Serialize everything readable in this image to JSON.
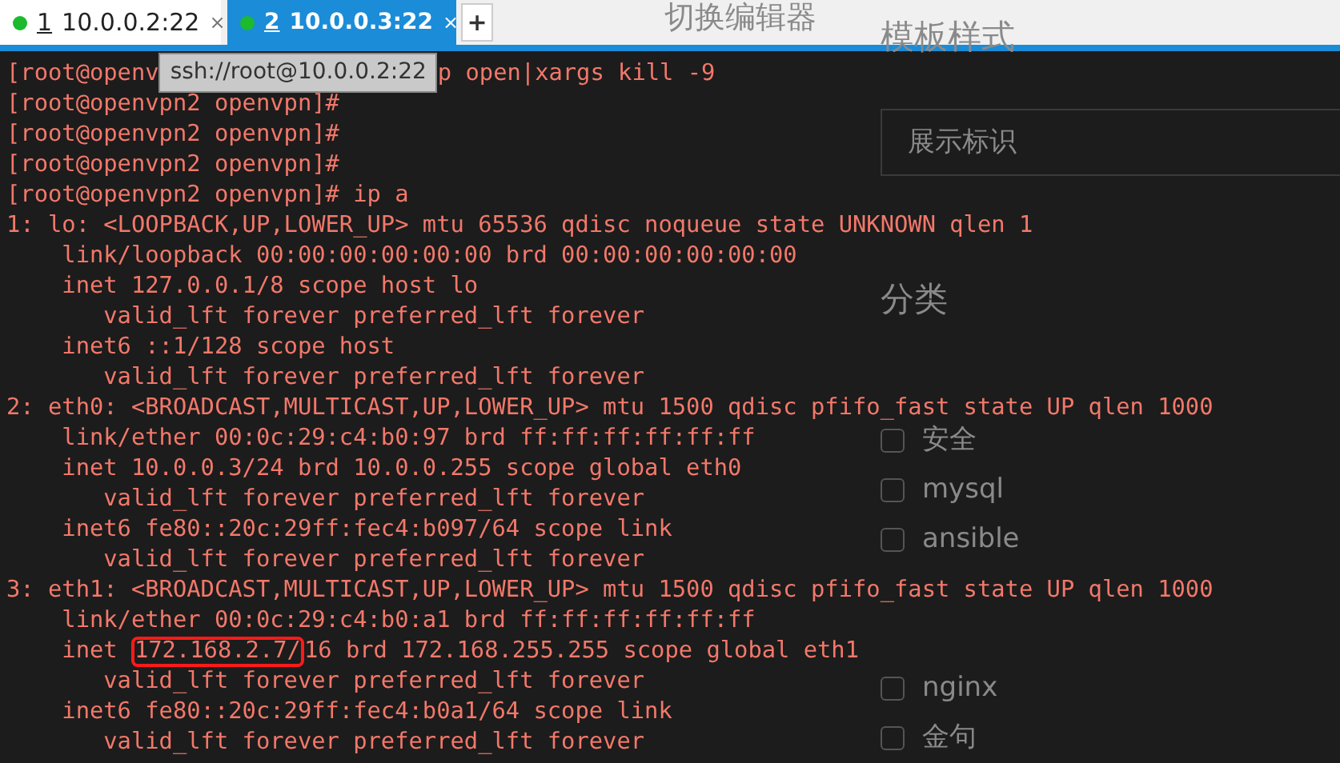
{
  "tabs": [
    {
      "number": "1",
      "title": "10.0.0.2:22",
      "close": "×",
      "selected": false,
      "connected": true
    },
    {
      "number": "2",
      "title": "10.0.0.3:22",
      "close": "×",
      "selected": true,
      "connected": true
    }
  ],
  "new_tab": "+",
  "editor_switch": "切换编辑器",
  "terminal": {
    "lines": [
      {
        "kind": "tooltip",
        "before": "[root@openv",
        "tooltip": "ssh://root@10.0.0.2:22",
        "after": "p open|xargs kill -9"
      },
      {
        "kind": "plain",
        "text": "[root@openvpn2 openvpn]#"
      },
      {
        "kind": "plain",
        "text": "[root@openvpn2 openvpn]#"
      },
      {
        "kind": "plain",
        "text": "[root@openvpn2 openvpn]#"
      },
      {
        "kind": "plain",
        "text": "[root@openvpn2 openvpn]# ip a"
      },
      {
        "kind": "plain",
        "text": "1: lo: <LOOPBACK,UP,LOWER_UP> mtu 65536 qdisc noqueue state UNKNOWN qlen 1"
      },
      {
        "kind": "plain",
        "text": "    link/loopback 00:00:00:00:00:00 brd 00:00:00:00:00:00"
      },
      {
        "kind": "plain",
        "text": "    inet 127.0.0.1/8 scope host lo"
      },
      {
        "kind": "plain",
        "text": "       valid_lft forever preferred_lft forever"
      },
      {
        "kind": "plain",
        "text": "    inet6 ::1/128 scope host"
      },
      {
        "kind": "plain",
        "text": "       valid_lft forever preferred_lft forever"
      },
      {
        "kind": "plain",
        "text": "2: eth0: <BROADCAST,MULTICAST,UP,LOWER_UP> mtu 1500 qdisc pfifo_fast state UP qlen 1000"
      },
      {
        "kind": "plain",
        "text": "    link/ether 00:0c:29:c4:b0:97 brd ff:ff:ff:ff:ff:ff"
      },
      {
        "kind": "plain",
        "text": "    inet 10.0.0.3/24 brd 10.0.0.255 scope global eth0"
      },
      {
        "kind": "plain",
        "text": "       valid_lft forever preferred_lft forever"
      },
      {
        "kind": "plain",
        "text": "    inet6 fe80::20c:29ff:fec4:b097/64 scope link"
      },
      {
        "kind": "plain",
        "text": "       valid_lft forever preferred_lft forever"
      },
      {
        "kind": "plain",
        "text": "3: eth1: <BROADCAST,MULTICAST,UP,LOWER_UP> mtu 1500 qdisc pfifo_fast state UP qlen 1000"
      },
      {
        "kind": "plain",
        "text": "    link/ether 00:0c:29:c4:b0:a1 brd ff:ff:ff:ff:ff:ff"
      },
      {
        "kind": "highlight",
        "before": "    inet ",
        "highlight": "172.168.2.7/",
        "after": "16 brd 172.168.255.255 scope global eth1"
      },
      {
        "kind": "plain",
        "text": "       valid_lft forever preferred_lft forever"
      },
      {
        "kind": "plain",
        "text": "    inet6 fe80::20c:29ff:fec4:b0a1/64 scope link"
      },
      {
        "kind": "plain",
        "text": "       valid_lft forever preferred_lft forever"
      }
    ]
  },
  "background_page": {
    "title": "模板样式",
    "field": {
      "placeholder": "展示标识"
    },
    "category_heading": "分类",
    "categories": [
      {
        "label": "安全",
        "checked": false
      },
      {
        "label": "mysql",
        "checked": false
      },
      {
        "label": "ansible",
        "checked": false
      },
      {
        "label": "nginx",
        "checked": false
      },
      {
        "label": "金句",
        "checked": false
      }
    ]
  }
}
